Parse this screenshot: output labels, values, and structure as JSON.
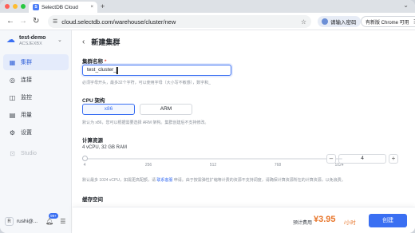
{
  "browser": {
    "tab_title": "SelectDB Cloud",
    "tab_favicon": "S",
    "tab_close": "×",
    "new_tab": "+",
    "tab_dropdown": "⌄",
    "back": "←",
    "forward": "→",
    "reload": "↻",
    "url": "cloud.selectdb.com/warehouse/cluster/new",
    "password_chip": "请输入密码",
    "update_chip": "有新版 Chrome 可用",
    "menu": "⋮"
  },
  "sidebar": {
    "org_name": "test-demo",
    "org_id": "ACSJEXBX",
    "org_chevron": "⌄",
    "items": [
      {
        "label": "集群",
        "icon": "▦",
        "active": true
      },
      {
        "label": "连接",
        "icon": "◎",
        "active": false
      },
      {
        "label": "监控",
        "icon": "◫",
        "active": false
      },
      {
        "label": "用量",
        "icon": "▤",
        "active": false
      },
      {
        "label": "设置",
        "icon": "⚙",
        "active": false
      },
      {
        "label": "Studio",
        "icon": "⊡",
        "active": false
      }
    ],
    "user_initial": "R",
    "user_name": "rushi@...",
    "notification_badge": "99+"
  },
  "page": {
    "back": "‹",
    "title": "新建集群",
    "name_label": "集群名称",
    "required_mark": "*",
    "name_value": "test_cluster_",
    "name_hint": "必须字母开头，最多32个字符，可以使用字母（大小写不敏感），数字和_",
    "arch_label": "CPU 架构",
    "arch_options": [
      "x86",
      "ARM"
    ],
    "arch_selected": "x86",
    "arch_hint": "默认为 x86，您可以根据需要选择 ARM 架构。集群创建后不支持修改。",
    "compute_label": "计算资源",
    "compute_value": "4 vCPU, 32 GB RAM",
    "slider_ticks": [
      "4",
      "256",
      "512",
      "768",
      "1024"
    ],
    "stepper_minus": "–",
    "stepper_value": "4",
    "stepper_plus": "+",
    "compute_hint_pre": "默认最多 1024 vCPU，如需更高配额，请",
    "compute_hint_link": "联系客服",
    "compute_hint_post": "申请。由于按需弹性扩缩等计费的资源不支持调度，请确保计算资源所在的计算资源，以免浪费。",
    "cache_label": "缓存空间"
  },
  "footer": {
    "price_label": "预计费用",
    "price": "¥3.95",
    "price_unit": "/小时",
    "create_label": "创建"
  },
  "colors": {
    "accent": "#3a6ff2",
    "price": "#e8762b",
    "sidebar_bg": "#f5f7fa",
    "required": "#e0473a"
  }
}
